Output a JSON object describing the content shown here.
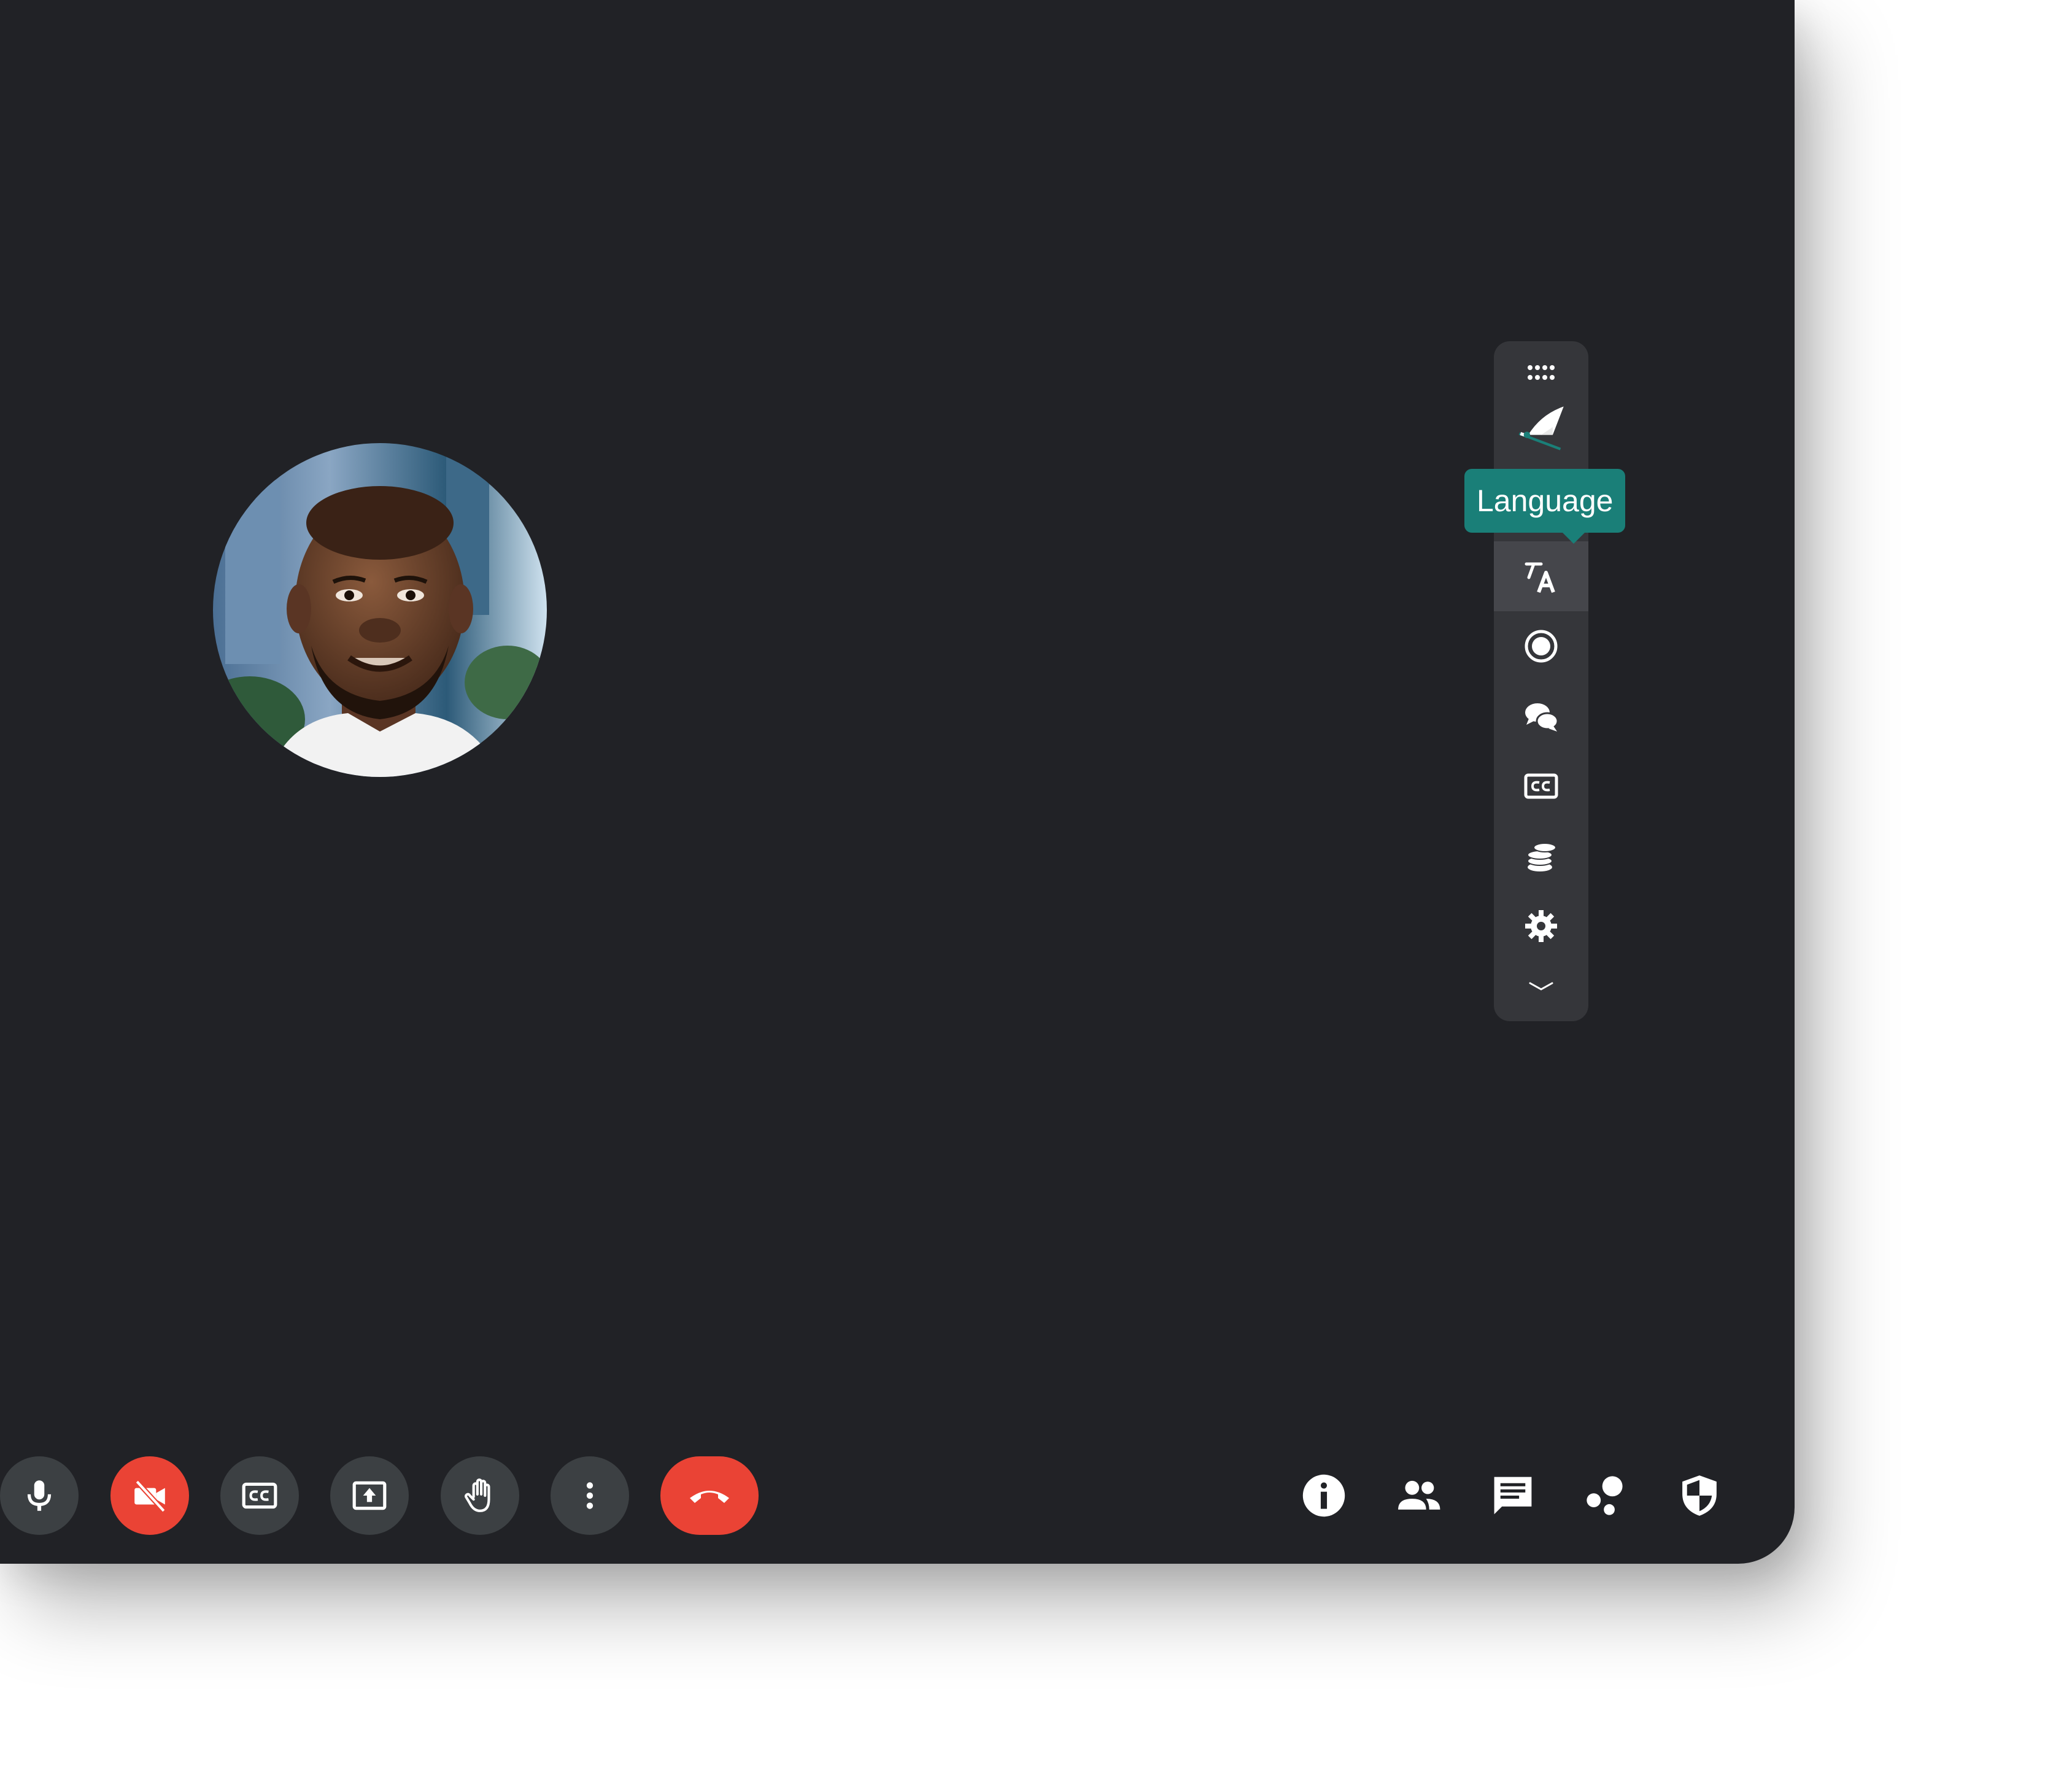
{
  "colors": {
    "window_bg": "#212226",
    "toolbar_bg": "#35363a",
    "button_bg": "#3c4043",
    "danger": "#ea4335",
    "tooltip_bg": "#1a7f78"
  },
  "participant": {
    "avatar": "participant-photo"
  },
  "side_toolbar": {
    "items": [
      {
        "icon": "drag-handle-icon"
      },
      {
        "icon": "logo-icon"
      },
      {
        "icon": "translate-icon",
        "active": true
      },
      {
        "icon": "record-icon"
      },
      {
        "icon": "chat-bubbles-icon"
      },
      {
        "icon": "closed-captions-icon"
      },
      {
        "icon": "coins-icon"
      },
      {
        "icon": "settings-icon"
      },
      {
        "icon": "chevron-down-icon"
      }
    ],
    "tooltip": "Language"
  },
  "controls": {
    "left": [
      "microphone-icon",
      "camera-off-icon",
      "captions-icon",
      "present-icon",
      "raise-hand-icon",
      "more-vert-icon",
      "end-call-icon"
    ],
    "right": [
      "info-icon",
      "people-icon",
      "chat-icon",
      "activities-icon",
      "host-controls-icon"
    ]
  }
}
